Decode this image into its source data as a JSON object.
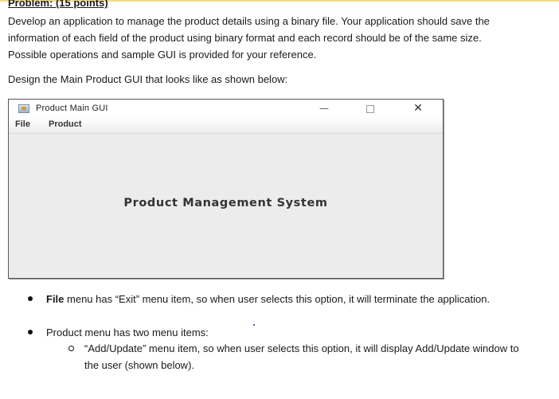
{
  "document": {
    "problem_title": "Problem: (15 points)",
    "intro": "Develop an application to manage the product details using a binary file. Your application should save the information of each field of the product using binary format and each record should be of the same size. Possible operations and sample GUI is provided for your reference.",
    "design_line": "Design the Main Product GUI that looks like as shown below:"
  },
  "window": {
    "title": "Product Main GUI",
    "controls": {
      "minimize": "—",
      "close": "✕"
    },
    "menus": [
      "File",
      "Product"
    ],
    "heading": "Product Management System"
  },
  "bullets": {
    "file_menu_lead": "File",
    "file_menu_text": " menu has “Exit” menu item, so when user selects this option, it will terminate the application.",
    "product_menu_text": "Product menu has two menu items:",
    "add_update_text": "“Add/Update” menu item, so when user selects this option, it will display Add/Update window to the user (shown below)."
  },
  "colors": {
    "top_border": "#f3dc7a",
    "window_bg": "#ececec"
  }
}
